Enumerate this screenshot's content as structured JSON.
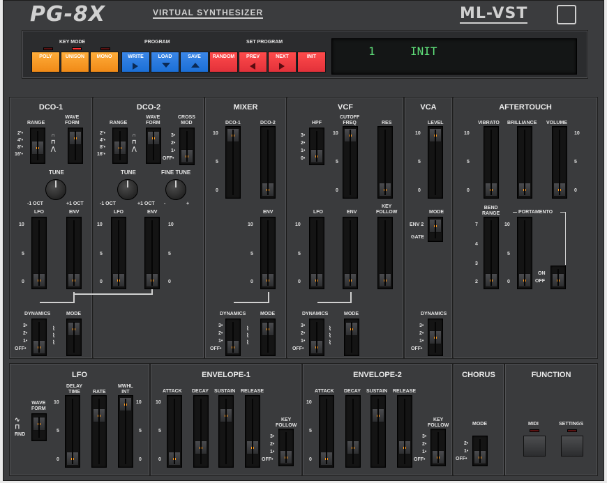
{
  "header": {
    "logo": "PG-8X",
    "subtitle": "VIRTUAL SYNTHESIZER",
    "brand": "ML-VST"
  },
  "controls": {
    "key_mode": {
      "title": "KEY MODE",
      "buttons": [
        "POLY",
        "UNISON",
        "MONO"
      ]
    },
    "program": {
      "title": "PROGRAM",
      "buttons": [
        "WRITE",
        "LOAD",
        "SAVE"
      ]
    },
    "set_program": {
      "title": "SET PROGRAM",
      "buttons": [
        "RANDOM",
        "PREV",
        "NEXT",
        "INIT"
      ]
    }
  },
  "display": {
    "program_number": "1",
    "program_name": "INIT"
  },
  "sections": {
    "dco1": {
      "title": "DCO-1",
      "range": "RANGE",
      "wave": "WAVE\nFORM",
      "tune": "TUNE",
      "tune_min": "-1 OCT",
      "tune_max": "+1 OCT",
      "lfo": "LFO",
      "env": "ENV",
      "dynamics": "DYNAMICS",
      "mode": "MODE"
    },
    "dco2": {
      "title": "DCO-2",
      "range": "RANGE",
      "wave": "WAVE\nFORM",
      "cross": "CROSS\nMOD",
      "tune": "TUNE",
      "fine": "FINE TUNE",
      "tune_min": "-1 OCT",
      "tune_max": "+1 OCT",
      "fine_min": "-",
      "fine_max": "+",
      "lfo": "LFO",
      "env": "ENV"
    },
    "mixer": {
      "title": "MIXER",
      "dco1": "DCO-1",
      "dco2": "DCO-2",
      "env": "ENV",
      "dynamics": "DYNAMICS",
      "mode": "MODE"
    },
    "vcf": {
      "title": "VCF",
      "hpf": "HPF",
      "cutoff": "CUTOFF\nFREQ",
      "res": "RES",
      "lfo": "LFO",
      "env": "ENV",
      "key": "KEY\nFOLLOW",
      "dynamics": "DYNAMICS",
      "mode": "MODE"
    },
    "vca": {
      "title": "VCA",
      "level": "LEVEL",
      "mode": "MODE",
      "env2": "ENV 2",
      "gate": "GATE",
      "dynamics": "DYNAMICS"
    },
    "aftertouch": {
      "title": "AFTERTOUCH",
      "vibrato": "VIBRATO",
      "brilliance": "BRILLIANCE",
      "volume": "VOLUME",
      "bend": "BEND\nRANGE",
      "portamento": "PORTAMENTO",
      "on": "ON",
      "off": "OFF"
    },
    "lfo": {
      "title": "LFO",
      "wave": "WAVE\nFORM",
      "delay": "DELAY\nTIME",
      "rate": "RATE",
      "mwhl": "MWHL\nINT",
      "rnd": "RND"
    },
    "env1": {
      "title": "ENVELOPE-1",
      "attack": "ATTACK",
      "decay": "DECAY",
      "sustain": "SUSTAIN",
      "release": "RELEASE",
      "key": "KEY\nFOLLOW"
    },
    "env2": {
      "title": "ENVELOPE-2",
      "attack": "ATTACK",
      "decay": "DECAY",
      "sustain": "SUSTAIN",
      "release": "RELEASE",
      "key": "KEY\nFOLLOW"
    },
    "chorus": {
      "title": "CHORUS",
      "mode": "MODE"
    },
    "function": {
      "title": "FUNCTION",
      "midi": "MIDI",
      "settings": "SETTINGS"
    }
  },
  "scale": {
    "ten": "10",
    "five": "5",
    "zero": "0",
    "seven": "7",
    "four": "4",
    "three": "3",
    "two": "2",
    "one": "1",
    "off": "OFF",
    "eight": "8",
    "sixteen": "16"
  },
  "colors": {
    "orange": "#f7991f",
    "blue": "#2a7be0",
    "red": "#e93a3f",
    "lcd": "#5fe07a"
  }
}
